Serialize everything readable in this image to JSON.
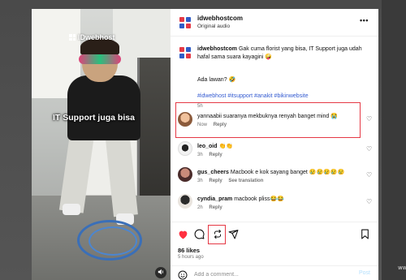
{
  "video": {
    "watermark": "IDwebhost",
    "caption": "IT Support juga bisa",
    "sound_icon": "speaker-icon"
  },
  "post": {
    "username": "idwebhostcom",
    "audio": "Original audio",
    "caption": {
      "username": "idwebhostcom",
      "text": "Gak cuma florist yang bisa, IT Support juga udah hafal sama suara kayagini 🤪",
      "line2": "Ada lawan? 🤣",
      "hashtags": "#idwebhost #itsupport #anakit #bikinwebsite",
      "time": "5h"
    },
    "comments": [
      {
        "username": "yannaabii",
        "text": "suaranya mekbuknya renyah banget mind 😭",
        "time": "Now",
        "reply_label": "Reply"
      },
      {
        "username": "leo_oid",
        "text": "👏👏",
        "time": "3h",
        "reply_label": "Reply"
      },
      {
        "username": "gus_cheers",
        "text": "Macbook e kok sayang banget 😢😢😢😢😢",
        "time": "3h",
        "reply_label": "Reply",
        "translation_label": "See translation"
      },
      {
        "username": "cyndia_pram",
        "text": "macbook pliss😂😂",
        "time": "2h",
        "reply_label": "Reply"
      }
    ],
    "likes": "86 likes",
    "posted": "5 hours ago",
    "add_comment_placeholder": "Add a comment...",
    "post_label": "Post"
  },
  "screen": {
    "stamp": "ww"
  },
  "colors": {
    "accent_blue": "#345bd1",
    "like_red": "#ff3040",
    "highlight_red": "#e53945",
    "brand_red": "#e53945",
    "brand_blue": "#2f5cc8"
  }
}
